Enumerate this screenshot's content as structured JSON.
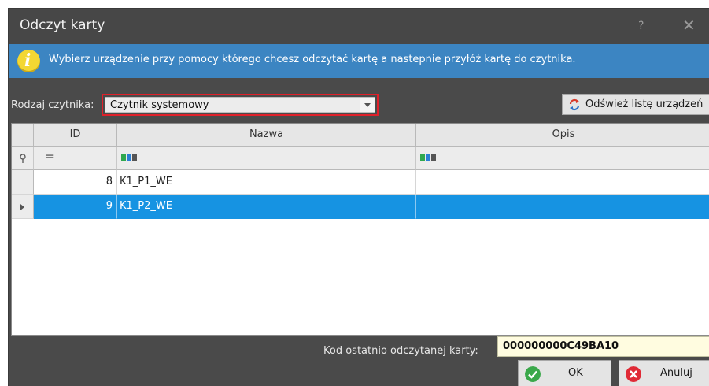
{
  "window": {
    "title": "Odczyt karty",
    "help_glyph": "?",
    "close_glyph": "✕"
  },
  "info": {
    "icon": "info-icon",
    "glyph": "i",
    "message": "Wybierz urządzenie przy pomocy którego chcesz odczytać kartę a nastepnie przyłóż kartę do czytnika."
  },
  "reader": {
    "label": "Rodzaj czytnika:",
    "selected": "Czytnik systemowy"
  },
  "refresh_button": {
    "label": "Odśwież listę urządzeń"
  },
  "grid": {
    "columns": [
      "ID",
      "Nazwa",
      "Opis"
    ],
    "filter_row": {
      "id_operator": "="
    },
    "rows": [
      {
        "id": "8",
        "name": "K1_P1_WE",
        "desc": "",
        "selected": false
      },
      {
        "id": "9",
        "name": "K1_P2_WE",
        "desc": "",
        "selected": true
      }
    ]
  },
  "footer": {
    "last_card_label": "Kod ostatnio odczytanej karty:",
    "last_card_value": "000000000C49BA10",
    "ok_label": "OK",
    "cancel_label": "Anuluj"
  },
  "colors": {
    "title_bg": "#474747",
    "info_bg": "#3c85c2",
    "highlight_border": "#e0202a",
    "selected_row": "#1693e2"
  }
}
